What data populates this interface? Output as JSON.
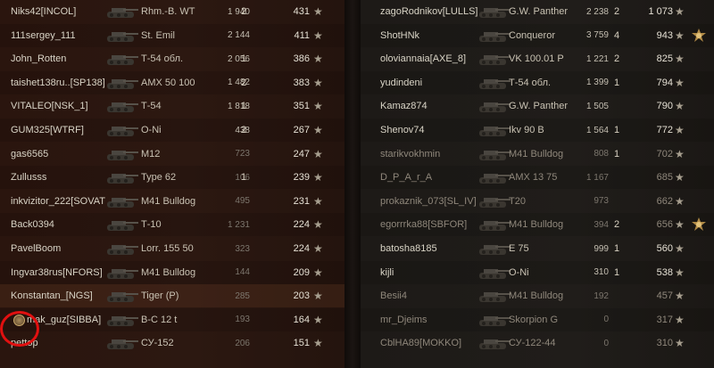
{
  "left_team": [
    {
      "player": "Niks42[INCOL]",
      "tank": "Rhm.-B. WT",
      "damage": "1 940",
      "kills": "2",
      "xp": "431"
    },
    {
      "player": "111sergey_111",
      "tank": "St. Emil",
      "damage": "2 144",
      "kills": "",
      "xp": "411"
    },
    {
      "player": "John_Rotten",
      "tank": "Т-54 обл.",
      "damage": "2 056",
      "kills": "1",
      "xp": "386"
    },
    {
      "player": "taishet138ru..[SP138]",
      "tank": "AMX 50 100",
      "damage": "1 482",
      "kills": "2",
      "xp": "383"
    },
    {
      "player": "VITALEO[NSK_1]",
      "tank": "Т-54",
      "damage": "1 818",
      "kills": "1",
      "xp": "351"
    },
    {
      "player": "GUM325[WTRF]",
      "tank": "O-Ni",
      "damage": "438",
      "kills": "2",
      "xp": "267"
    },
    {
      "player": "gas6565",
      "tank": "M12",
      "damage": "723",
      "kills": "",
      "xp": "247"
    },
    {
      "player": "Zullusss",
      "tank": "Type 62",
      "damage": "106",
      "kills": "1",
      "xp": "239"
    },
    {
      "player": "inkvizitor_222[SOVAT]",
      "tank": "M41 Bulldog",
      "damage": "495",
      "kills": "",
      "xp": "231"
    },
    {
      "player": "Back0394",
      "tank": "Т-10",
      "damage": "1 231",
      "kills": "",
      "xp": "224"
    },
    {
      "player": "PavelBoom",
      "tank": "Lorr. 155 50",
      "damage": "323",
      "kills": "",
      "xp": "224"
    },
    {
      "player": "Ingvar38rus[NFORS]",
      "tank": "M41 Bulldog",
      "damage": "144",
      "kills": "",
      "xp": "209"
    },
    {
      "player": "Konstantan_[NGS]",
      "tank": "Tiger (P)",
      "damage": "285",
      "kills": "",
      "xp": "203"
    },
    {
      "player": "mak_guz[SIBBA]",
      "tank": "B-C 12 t",
      "damage": "193",
      "kills": "",
      "xp": "164"
    },
    {
      "player": "pettop",
      "tank": "СУ-152",
      "damage": "206",
      "kills": "",
      "xp": "151"
    }
  ],
  "right_team": [
    {
      "player": "zagoRodnikov[LULLS]",
      "tank": "G.W. Panther",
      "damage": "2 238",
      "kills": "2",
      "xp": "1 073"
    },
    {
      "player": "ShotHNk",
      "tank": "Conqueror",
      "damage": "3 759",
      "kills": "4",
      "xp": "943"
    },
    {
      "player": "oloviannaia[AXE_8]",
      "tank": "VK 100.01 P",
      "damage": "1 221",
      "kills": "2",
      "xp": "825"
    },
    {
      "player": "yudindeni",
      "tank": "Т-54 обл.",
      "damage": "1 399",
      "kills": "1",
      "xp": "794"
    },
    {
      "player": "Kamaz874",
      "tank": "G.W. Panther",
      "damage": "1 505",
      "kills": "",
      "xp": "790"
    },
    {
      "player": "Shenov74",
      "tank": "Ikv 90 B",
      "damage": "1 564",
      "kills": "1",
      "xp": "772"
    },
    {
      "player": "starikvokhmin",
      "tank": "M41 Bulldog",
      "damage": "808",
      "kills": "1",
      "xp": "702"
    },
    {
      "player": "D_P_A_r_A",
      "tank": "AMX 13 75",
      "damage": "1 167",
      "kills": "",
      "xp": "685"
    },
    {
      "player": "prokaznik_073[SL_IV]",
      "tank": "T20",
      "damage": "973",
      "kills": "",
      "xp": "662"
    },
    {
      "player": "egorrrka88[SBFOR]",
      "tank": "M41 Bulldog",
      "damage": "394",
      "kills": "2",
      "xp": "656"
    },
    {
      "player": "batosha8185",
      "tank": "E 75",
      "damage": "999",
      "kills": "1",
      "xp": "560"
    },
    {
      "player": "kijli",
      "tank": "O-Ni",
      "damage": "310",
      "kills": "1",
      "xp": "538"
    },
    {
      "player": "Besii4",
      "tank": "M41 Bulldog",
      "damage": "192",
      "kills": "",
      "xp": "457"
    },
    {
      "player": "mr_Djeims",
      "tank": "Skorpion G",
      "damage": "0",
      "kills": "",
      "xp": "317"
    },
    {
      "player": "CblHA89[MOKKO]",
      "tank": "СУ-122-44",
      "damage": "0",
      "kills": "",
      "xp": "310"
    }
  ],
  "star_glyph": "★",
  "icons": {
    "tank": "tank-silhouette-icon",
    "medal": "medal-icon",
    "clan_badge": "clan-badge-icon"
  },
  "colors": {
    "annotation_circle": "#e11010",
    "left_bg": "#2c1811",
    "right_bg": "#201d1a"
  }
}
